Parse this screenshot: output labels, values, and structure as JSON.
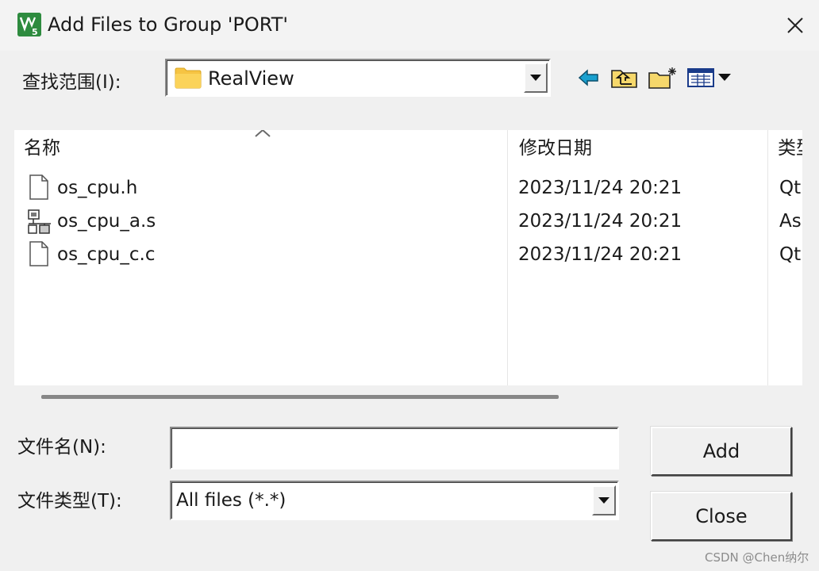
{
  "window": {
    "title": "Add Files to Group 'PORT'",
    "app_icon": "keil-uvision-icon"
  },
  "lookin": {
    "label": "查找范围(I):",
    "value": "RealView",
    "toolbar_icons": [
      "back-arrow-icon",
      "up-one-level-icon",
      "new-folder-icon",
      "view-menu-icon"
    ]
  },
  "list": {
    "columns": [
      "名称",
      "修改日期",
      "类型"
    ],
    "rows": [
      {
        "name": "os_cpu.h",
        "date": "2023/11/24 20:21",
        "type": "Qt",
        "icon": "document-icon"
      },
      {
        "name": "os_cpu_a.s",
        "date": "2023/11/24 20:21",
        "type": "As",
        "icon": "assembly-file-icon"
      },
      {
        "name": "os_cpu_c.c",
        "date": "2023/11/24 20:21",
        "type": "Qt",
        "icon": "document-icon"
      }
    ]
  },
  "filename": {
    "label": "文件名(N):",
    "value": ""
  },
  "filetype": {
    "label": "文件类型(T):",
    "value": "All files (*.*)"
  },
  "buttons": {
    "add": "Add",
    "close": "Close"
  },
  "watermark": "CSDN @Chen纳尔",
  "colors": {
    "background": "#f0f0f0",
    "list_background": "#ffffff",
    "folder_yellow": "#f6c443",
    "back_arrow": "#19a0cf"
  }
}
